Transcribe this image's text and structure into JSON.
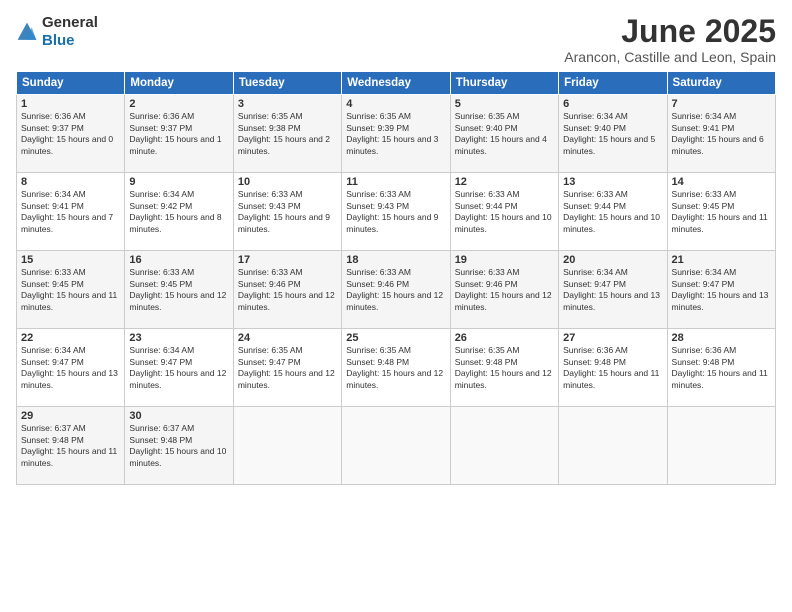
{
  "logo": {
    "general": "General",
    "blue": "Blue"
  },
  "title": "June 2025",
  "subtitle": "Arancon, Castille and Leon, Spain",
  "headers": [
    "Sunday",
    "Monday",
    "Tuesday",
    "Wednesday",
    "Thursday",
    "Friday",
    "Saturday"
  ],
  "weeks": [
    [
      {
        "day": "1",
        "rise": "Sunrise: 6:36 AM",
        "set": "Sunset: 9:37 PM",
        "day_text": "Daylight: 15 hours and 0 minutes."
      },
      {
        "day": "2",
        "rise": "Sunrise: 6:36 AM",
        "set": "Sunset: 9:37 PM",
        "day_text": "Daylight: 15 hours and 1 minute."
      },
      {
        "day": "3",
        "rise": "Sunrise: 6:35 AM",
        "set": "Sunset: 9:38 PM",
        "day_text": "Daylight: 15 hours and 2 minutes."
      },
      {
        "day": "4",
        "rise": "Sunrise: 6:35 AM",
        "set": "Sunset: 9:39 PM",
        "day_text": "Daylight: 15 hours and 3 minutes."
      },
      {
        "day": "5",
        "rise": "Sunrise: 6:35 AM",
        "set": "Sunset: 9:40 PM",
        "day_text": "Daylight: 15 hours and 4 minutes."
      },
      {
        "day": "6",
        "rise": "Sunrise: 6:34 AM",
        "set": "Sunset: 9:40 PM",
        "day_text": "Daylight: 15 hours and 5 minutes."
      },
      {
        "day": "7",
        "rise": "Sunrise: 6:34 AM",
        "set": "Sunset: 9:41 PM",
        "day_text": "Daylight: 15 hours and 6 minutes."
      }
    ],
    [
      {
        "day": "8",
        "rise": "Sunrise: 6:34 AM",
        "set": "Sunset: 9:41 PM",
        "day_text": "Daylight: 15 hours and 7 minutes."
      },
      {
        "day": "9",
        "rise": "Sunrise: 6:34 AM",
        "set": "Sunset: 9:42 PM",
        "day_text": "Daylight: 15 hours and 8 minutes."
      },
      {
        "day": "10",
        "rise": "Sunrise: 6:33 AM",
        "set": "Sunset: 9:43 PM",
        "day_text": "Daylight: 15 hours and 9 minutes."
      },
      {
        "day": "11",
        "rise": "Sunrise: 6:33 AM",
        "set": "Sunset: 9:43 PM",
        "day_text": "Daylight: 15 hours and 9 minutes."
      },
      {
        "day": "12",
        "rise": "Sunrise: 6:33 AM",
        "set": "Sunset: 9:44 PM",
        "day_text": "Daylight: 15 hours and 10 minutes."
      },
      {
        "day": "13",
        "rise": "Sunrise: 6:33 AM",
        "set": "Sunset: 9:44 PM",
        "day_text": "Daylight: 15 hours and 10 minutes."
      },
      {
        "day": "14",
        "rise": "Sunrise: 6:33 AM",
        "set": "Sunset: 9:45 PM",
        "day_text": "Daylight: 15 hours and 11 minutes."
      }
    ],
    [
      {
        "day": "15",
        "rise": "Sunrise: 6:33 AM",
        "set": "Sunset: 9:45 PM",
        "day_text": "Daylight: 15 hours and 11 minutes."
      },
      {
        "day": "16",
        "rise": "Sunrise: 6:33 AM",
        "set": "Sunset: 9:45 PM",
        "day_text": "Daylight: 15 hours and 12 minutes."
      },
      {
        "day": "17",
        "rise": "Sunrise: 6:33 AM",
        "set": "Sunset: 9:46 PM",
        "day_text": "Daylight: 15 hours and 12 minutes."
      },
      {
        "day": "18",
        "rise": "Sunrise: 6:33 AM",
        "set": "Sunset: 9:46 PM",
        "day_text": "Daylight: 15 hours and 12 minutes."
      },
      {
        "day": "19",
        "rise": "Sunrise: 6:33 AM",
        "set": "Sunset: 9:46 PM",
        "day_text": "Daylight: 15 hours and 12 minutes."
      },
      {
        "day": "20",
        "rise": "Sunrise: 6:34 AM",
        "set": "Sunset: 9:47 PM",
        "day_text": "Daylight: 15 hours and 13 minutes."
      },
      {
        "day": "21",
        "rise": "Sunrise: 6:34 AM",
        "set": "Sunset: 9:47 PM",
        "day_text": "Daylight: 15 hours and 13 minutes."
      }
    ],
    [
      {
        "day": "22",
        "rise": "Sunrise: 6:34 AM",
        "set": "Sunset: 9:47 PM",
        "day_text": "Daylight: 15 hours and 13 minutes."
      },
      {
        "day": "23",
        "rise": "Sunrise: 6:34 AM",
        "set": "Sunset: 9:47 PM",
        "day_text": "Daylight: 15 hours and 12 minutes."
      },
      {
        "day": "24",
        "rise": "Sunrise: 6:35 AM",
        "set": "Sunset: 9:47 PM",
        "day_text": "Daylight: 15 hours and 12 minutes."
      },
      {
        "day": "25",
        "rise": "Sunrise: 6:35 AM",
        "set": "Sunset: 9:48 PM",
        "day_text": "Daylight: 15 hours and 12 minutes."
      },
      {
        "day": "26",
        "rise": "Sunrise: 6:35 AM",
        "set": "Sunset: 9:48 PM",
        "day_text": "Daylight: 15 hours and 12 minutes."
      },
      {
        "day": "27",
        "rise": "Sunrise: 6:36 AM",
        "set": "Sunset: 9:48 PM",
        "day_text": "Daylight: 15 hours and 11 minutes."
      },
      {
        "day": "28",
        "rise": "Sunrise: 6:36 AM",
        "set": "Sunset: 9:48 PM",
        "day_text": "Daylight: 15 hours and 11 minutes."
      }
    ],
    [
      {
        "day": "29",
        "rise": "Sunrise: 6:37 AM",
        "set": "Sunset: 9:48 PM",
        "day_text": "Daylight: 15 hours and 11 minutes."
      },
      {
        "day": "30",
        "rise": "Sunrise: 6:37 AM",
        "set": "Sunset: 9:48 PM",
        "day_text": "Daylight: 15 hours and 10 minutes."
      },
      null,
      null,
      null,
      null,
      null
    ]
  ]
}
